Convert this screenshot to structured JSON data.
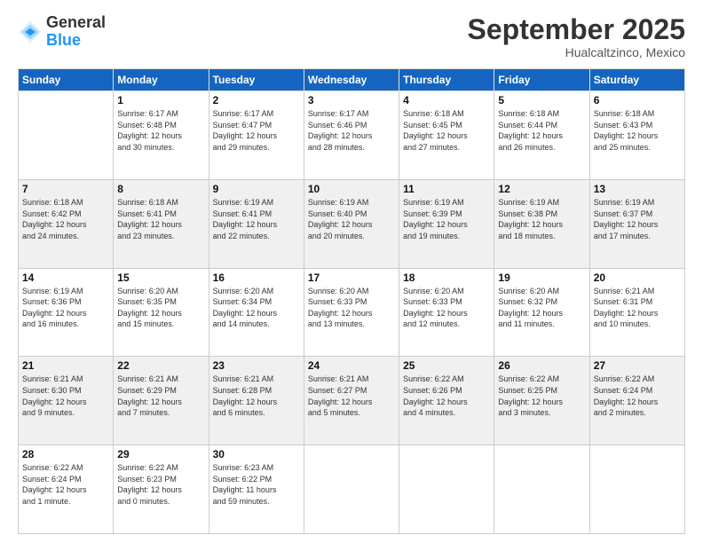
{
  "logo": {
    "general": "General",
    "blue": "Blue"
  },
  "header": {
    "month": "September 2025",
    "location": "Hualcaltzinco, Mexico"
  },
  "days_of_week": [
    "Sunday",
    "Monday",
    "Tuesday",
    "Wednesday",
    "Thursday",
    "Friday",
    "Saturday"
  ],
  "weeks": [
    [
      {
        "day": "",
        "info": ""
      },
      {
        "day": "1",
        "info": "Sunrise: 6:17 AM\nSunset: 6:48 PM\nDaylight: 12 hours\nand 30 minutes."
      },
      {
        "day": "2",
        "info": "Sunrise: 6:17 AM\nSunset: 6:47 PM\nDaylight: 12 hours\nand 29 minutes."
      },
      {
        "day": "3",
        "info": "Sunrise: 6:17 AM\nSunset: 6:46 PM\nDaylight: 12 hours\nand 28 minutes."
      },
      {
        "day": "4",
        "info": "Sunrise: 6:18 AM\nSunset: 6:45 PM\nDaylight: 12 hours\nand 27 minutes."
      },
      {
        "day": "5",
        "info": "Sunrise: 6:18 AM\nSunset: 6:44 PM\nDaylight: 12 hours\nand 26 minutes."
      },
      {
        "day": "6",
        "info": "Sunrise: 6:18 AM\nSunset: 6:43 PM\nDaylight: 12 hours\nand 25 minutes."
      }
    ],
    [
      {
        "day": "7",
        "info": "Sunrise: 6:18 AM\nSunset: 6:42 PM\nDaylight: 12 hours\nand 24 minutes."
      },
      {
        "day": "8",
        "info": "Sunrise: 6:18 AM\nSunset: 6:41 PM\nDaylight: 12 hours\nand 23 minutes."
      },
      {
        "day": "9",
        "info": "Sunrise: 6:19 AM\nSunset: 6:41 PM\nDaylight: 12 hours\nand 22 minutes."
      },
      {
        "day": "10",
        "info": "Sunrise: 6:19 AM\nSunset: 6:40 PM\nDaylight: 12 hours\nand 20 minutes."
      },
      {
        "day": "11",
        "info": "Sunrise: 6:19 AM\nSunset: 6:39 PM\nDaylight: 12 hours\nand 19 minutes."
      },
      {
        "day": "12",
        "info": "Sunrise: 6:19 AM\nSunset: 6:38 PM\nDaylight: 12 hours\nand 18 minutes."
      },
      {
        "day": "13",
        "info": "Sunrise: 6:19 AM\nSunset: 6:37 PM\nDaylight: 12 hours\nand 17 minutes."
      }
    ],
    [
      {
        "day": "14",
        "info": "Sunrise: 6:19 AM\nSunset: 6:36 PM\nDaylight: 12 hours\nand 16 minutes."
      },
      {
        "day": "15",
        "info": "Sunrise: 6:20 AM\nSunset: 6:35 PM\nDaylight: 12 hours\nand 15 minutes."
      },
      {
        "day": "16",
        "info": "Sunrise: 6:20 AM\nSunset: 6:34 PM\nDaylight: 12 hours\nand 14 minutes."
      },
      {
        "day": "17",
        "info": "Sunrise: 6:20 AM\nSunset: 6:33 PM\nDaylight: 12 hours\nand 13 minutes."
      },
      {
        "day": "18",
        "info": "Sunrise: 6:20 AM\nSunset: 6:33 PM\nDaylight: 12 hours\nand 12 minutes."
      },
      {
        "day": "19",
        "info": "Sunrise: 6:20 AM\nSunset: 6:32 PM\nDaylight: 12 hours\nand 11 minutes."
      },
      {
        "day": "20",
        "info": "Sunrise: 6:21 AM\nSunset: 6:31 PM\nDaylight: 12 hours\nand 10 minutes."
      }
    ],
    [
      {
        "day": "21",
        "info": "Sunrise: 6:21 AM\nSunset: 6:30 PM\nDaylight: 12 hours\nand 9 minutes."
      },
      {
        "day": "22",
        "info": "Sunrise: 6:21 AM\nSunset: 6:29 PM\nDaylight: 12 hours\nand 7 minutes."
      },
      {
        "day": "23",
        "info": "Sunrise: 6:21 AM\nSunset: 6:28 PM\nDaylight: 12 hours\nand 6 minutes."
      },
      {
        "day": "24",
        "info": "Sunrise: 6:21 AM\nSunset: 6:27 PM\nDaylight: 12 hours\nand 5 minutes."
      },
      {
        "day": "25",
        "info": "Sunrise: 6:22 AM\nSunset: 6:26 PM\nDaylight: 12 hours\nand 4 minutes."
      },
      {
        "day": "26",
        "info": "Sunrise: 6:22 AM\nSunset: 6:25 PM\nDaylight: 12 hours\nand 3 minutes."
      },
      {
        "day": "27",
        "info": "Sunrise: 6:22 AM\nSunset: 6:24 PM\nDaylight: 12 hours\nand 2 minutes."
      }
    ],
    [
      {
        "day": "28",
        "info": "Sunrise: 6:22 AM\nSunset: 6:24 PM\nDaylight: 12 hours\nand 1 minute."
      },
      {
        "day": "29",
        "info": "Sunrise: 6:22 AM\nSunset: 6:23 PM\nDaylight: 12 hours\nand 0 minutes."
      },
      {
        "day": "30",
        "info": "Sunrise: 6:23 AM\nSunset: 6:22 PM\nDaylight: 11 hours\nand 59 minutes."
      },
      {
        "day": "",
        "info": ""
      },
      {
        "day": "",
        "info": ""
      },
      {
        "day": "",
        "info": ""
      },
      {
        "day": "",
        "info": ""
      }
    ]
  ]
}
